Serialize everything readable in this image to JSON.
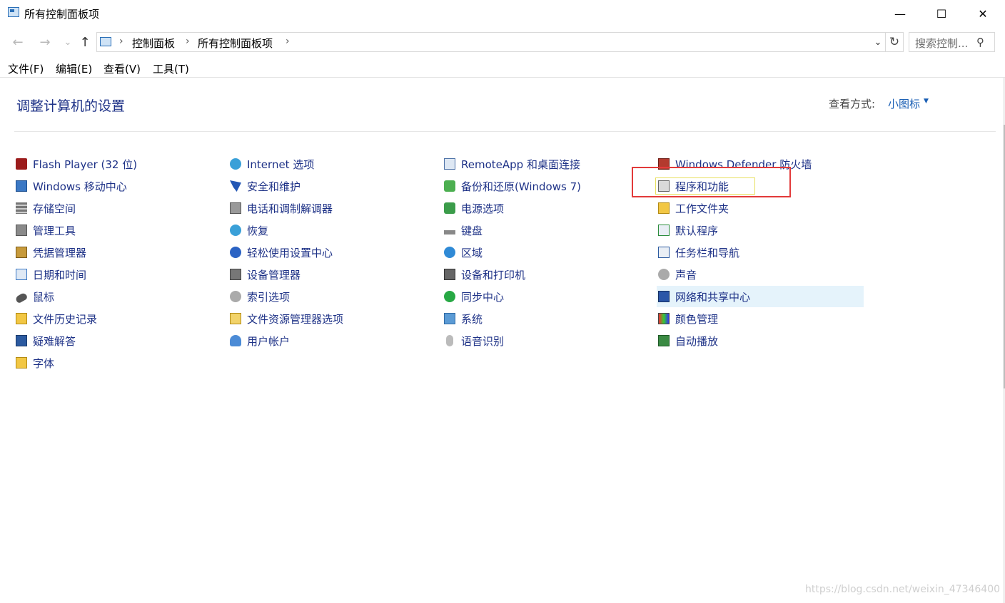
{
  "window": {
    "title": "所有控制面板项",
    "controls": {
      "minimize": "—",
      "maximize": "☐",
      "close": "✕"
    }
  },
  "nav": {
    "back": "←",
    "forward": "→",
    "recent": "⌄",
    "up": "↑",
    "breadcrumb": [
      "控制面板",
      "所有控制面板项"
    ],
    "separator": "›",
    "dropdown": "⌄",
    "refresh": "↻",
    "search_placeholder": "搜索控制...",
    "search_icon": "⚲"
  },
  "menu": [
    "文件(F)",
    "编辑(E)",
    "查看(V)",
    "工具(T)"
  ],
  "header": {
    "title": "调整计算机的设置",
    "view_by_label": "查看方式:",
    "view_by_value": "小图标",
    "caret": "▼"
  },
  "items": {
    "col1": [
      {
        "label": "Flash Player (32 位)",
        "icon": "flash-icon"
      },
      {
        "label": "Windows 移动中心",
        "icon": "mobility-center-icon"
      },
      {
        "label": "存储空间",
        "icon": "storage-spaces-icon"
      },
      {
        "label": "管理工具",
        "icon": "admin-tools-icon"
      },
      {
        "label": "凭据管理器",
        "icon": "credential-manager-icon"
      },
      {
        "label": "日期和时间",
        "icon": "date-time-icon"
      },
      {
        "label": "鼠标",
        "icon": "mouse-icon"
      },
      {
        "label": "文件历史记录",
        "icon": "file-history-icon"
      },
      {
        "label": "疑难解答",
        "icon": "troubleshooting-icon"
      },
      {
        "label": "字体",
        "icon": "fonts-icon"
      }
    ],
    "col2": [
      {
        "label": "Internet 选项",
        "icon": "internet-options-icon"
      },
      {
        "label": "安全和维护",
        "icon": "security-maintenance-icon"
      },
      {
        "label": "电话和调制解调器",
        "icon": "phone-modem-icon"
      },
      {
        "label": "恢复",
        "icon": "recovery-icon"
      },
      {
        "label": "轻松使用设置中心",
        "icon": "ease-of-access-icon"
      },
      {
        "label": "设备管理器",
        "icon": "device-manager-icon"
      },
      {
        "label": "索引选项",
        "icon": "indexing-options-icon"
      },
      {
        "label": "文件资源管理器选项",
        "icon": "explorer-options-icon"
      },
      {
        "label": "用户帐户",
        "icon": "user-accounts-icon"
      }
    ],
    "col3": [
      {
        "label": "RemoteApp 和桌面连接",
        "icon": "remoteapp-icon"
      },
      {
        "label": "备份和还原(Windows 7)",
        "icon": "backup-restore-icon"
      },
      {
        "label": "电源选项",
        "icon": "power-options-icon"
      },
      {
        "label": "键盘",
        "icon": "keyboard-icon"
      },
      {
        "label": "区域",
        "icon": "region-icon"
      },
      {
        "label": "设备和打印机",
        "icon": "devices-printers-icon"
      },
      {
        "label": "同步中心",
        "icon": "sync-center-icon"
      },
      {
        "label": "系统",
        "icon": "system-icon"
      },
      {
        "label": "语音识别",
        "icon": "speech-recognition-icon"
      }
    ],
    "col4": [
      {
        "label": "Windows Defender 防火墙",
        "icon": "firewall-icon"
      },
      {
        "label": "程序和功能",
        "icon": "programs-features-icon"
      },
      {
        "label": "工作文件夹",
        "icon": "work-folders-icon"
      },
      {
        "label": "默认程序",
        "icon": "default-programs-icon"
      },
      {
        "label": "任务栏和导航",
        "icon": "taskbar-navigation-icon"
      },
      {
        "label": "声音",
        "icon": "sound-icon"
      },
      {
        "label": "网络和共享中心",
        "icon": "network-sharing-icon"
      },
      {
        "label": "颜色管理",
        "icon": "color-management-icon"
      },
      {
        "label": "自动播放",
        "icon": "autoplay-icon"
      }
    ]
  },
  "watermark": "https://blog.csdn.net/weixin_47346400",
  "colors": {
    "link": "#1e3287",
    "title": "#1e3287",
    "hover": "#e5f3fb",
    "annotation_red": "#e23a3a"
  }
}
